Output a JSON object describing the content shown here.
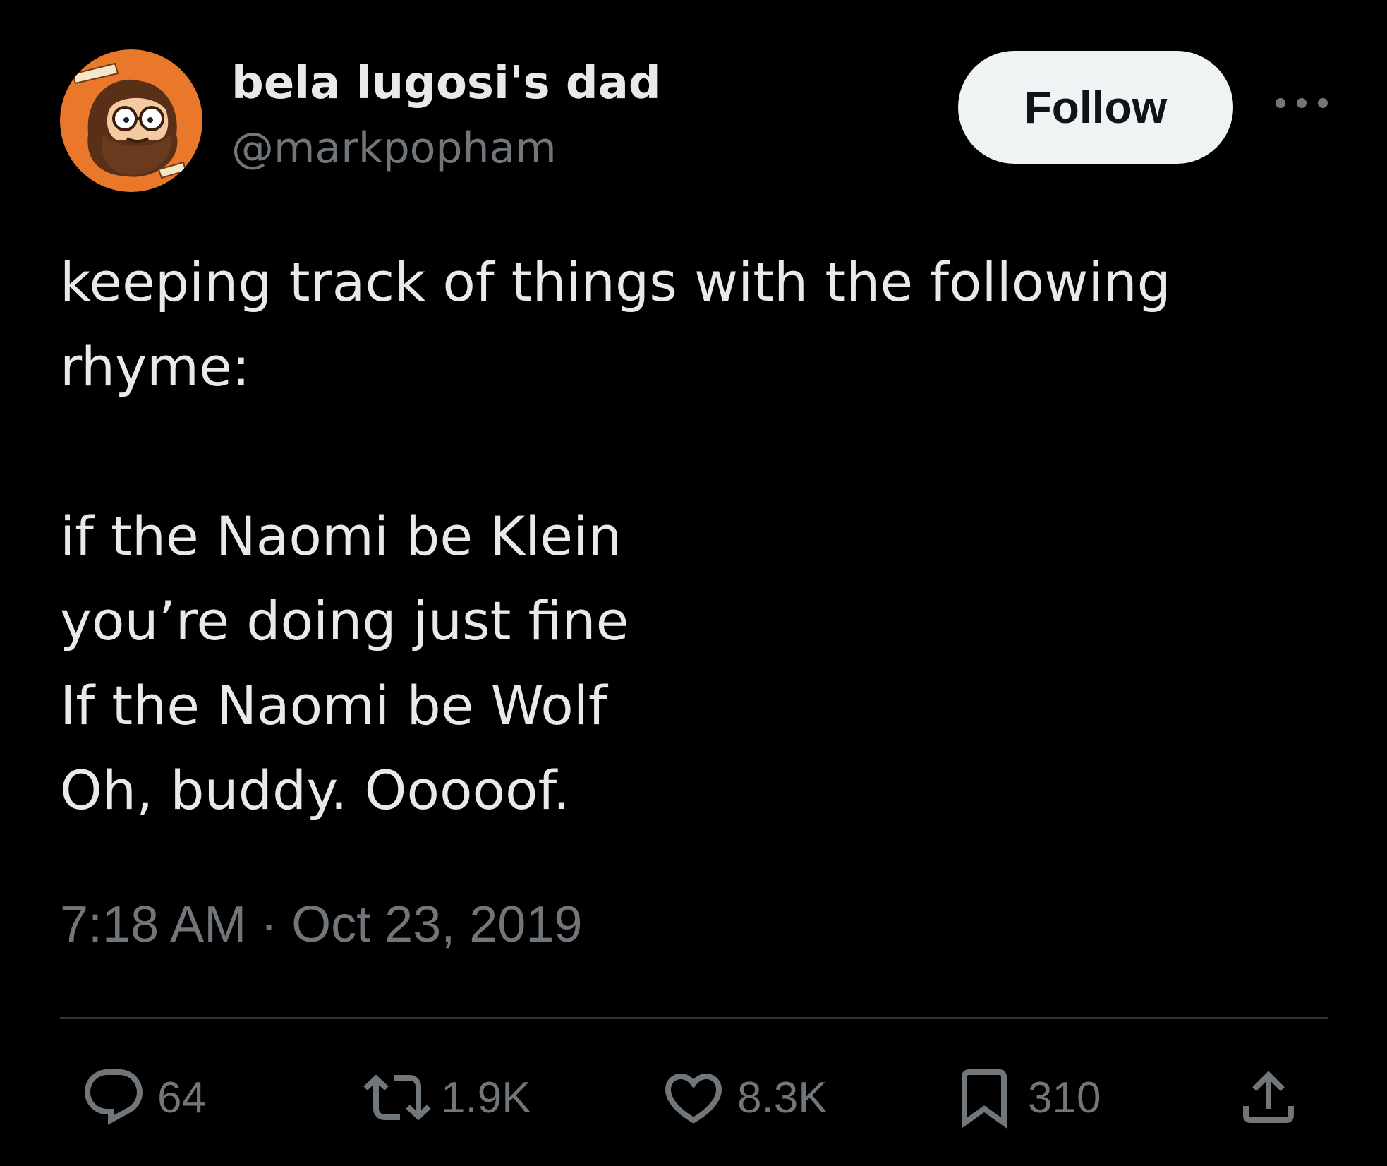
{
  "author": {
    "display_name": "bela lugosi's dad",
    "handle": "@markpopham"
  },
  "header": {
    "follow_label": "Follow",
    "more_icon": "more-horizontal-icon"
  },
  "tweet": {
    "text": "keeping track of things with the following\nrhyme:\n\nif the Naomi be Klein\nyou’re doing just fine\nIf the Naomi be Wolf\nOh, buddy. Ooooof.",
    "timestamp": "7:18 AM · Oct 23, 2019"
  },
  "actions": {
    "replies": "64",
    "reposts": "1.9K",
    "likes": "8.3K",
    "bookmarks": "310",
    "icons": [
      "reply-icon",
      "repost-icon",
      "like-icon",
      "bookmark-icon",
      "share-icon"
    ]
  },
  "colors": {
    "background": "#000000",
    "primary_text": "#e7e9ea",
    "secondary_text": "#71767b",
    "follow_button_bg": "#eff3f4",
    "divider": "#2f3336"
  }
}
